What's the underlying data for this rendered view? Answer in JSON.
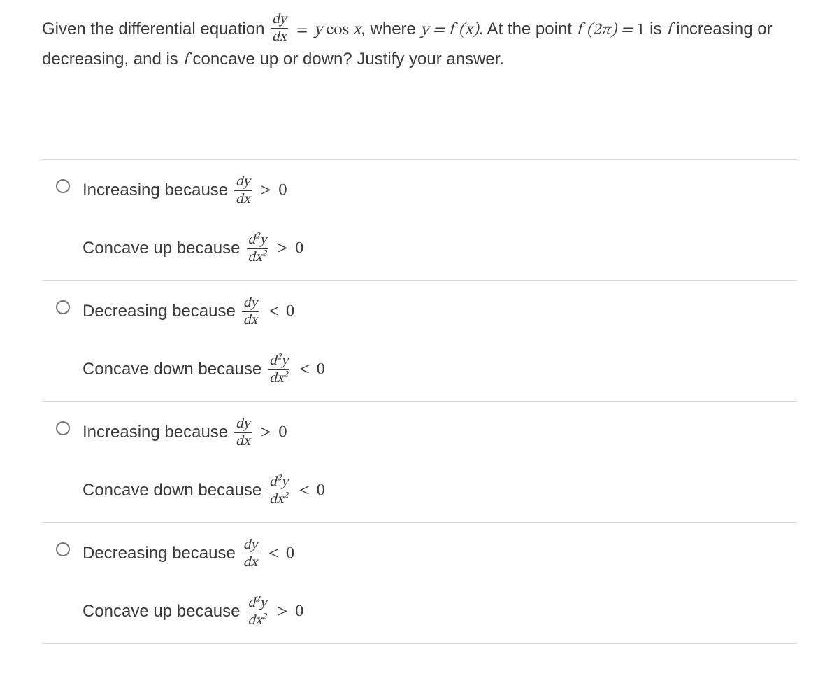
{
  "question": {
    "pre_frac": "Given the differential equation ",
    "frac_num": "dy",
    "frac_den": "dx",
    "eq1": " = ",
    "rhs1": "y cos x",
    "where": ", where ",
    "yeq": "y = f (x)",
    "post1": ". At the point ",
    "fval": "f (2π) = 1",
    "post2": " is ",
    "f1": "f",
    "post3": " increasing or decreasing, and is ",
    "f2": "f",
    "post4": " concave up or down? Justify your answer."
  },
  "options": [
    {
      "line1_label": "Increasing because",
      "line1_num": "dy",
      "line1_den": "dx",
      "line1_rel": ">",
      "line1_zero": "0",
      "line2_label": "Concave up because",
      "line2_num": "d²y",
      "line2_den": "dx²",
      "line2_rel": ">",
      "line2_zero": "0"
    },
    {
      "line1_label": "Decreasing because",
      "line1_num": "dy",
      "line1_den": "dx",
      "line1_rel": "<",
      "line1_zero": "0",
      "line2_label": "Concave down because",
      "line2_num": "d²y",
      "line2_den": "dx²",
      "line2_rel": "<",
      "line2_zero": "0"
    },
    {
      "line1_label": "Increasing because",
      "line1_num": "dy",
      "line1_den": "dx",
      "line1_rel": ">",
      "line1_zero": "0",
      "line2_label": "Concave down because",
      "line2_num": "d²y",
      "line2_den": "dx²",
      "line2_rel": "<",
      "line2_zero": "0"
    },
    {
      "line1_label": "Decreasing because",
      "line1_num": "dy",
      "line1_den": "dx",
      "line1_rel": "<",
      "line1_zero": "0",
      "line2_label": "Concave up because",
      "line2_num": "d²y",
      "line2_den": "dx²",
      "line2_rel": ">",
      "line2_zero": "0"
    }
  ]
}
